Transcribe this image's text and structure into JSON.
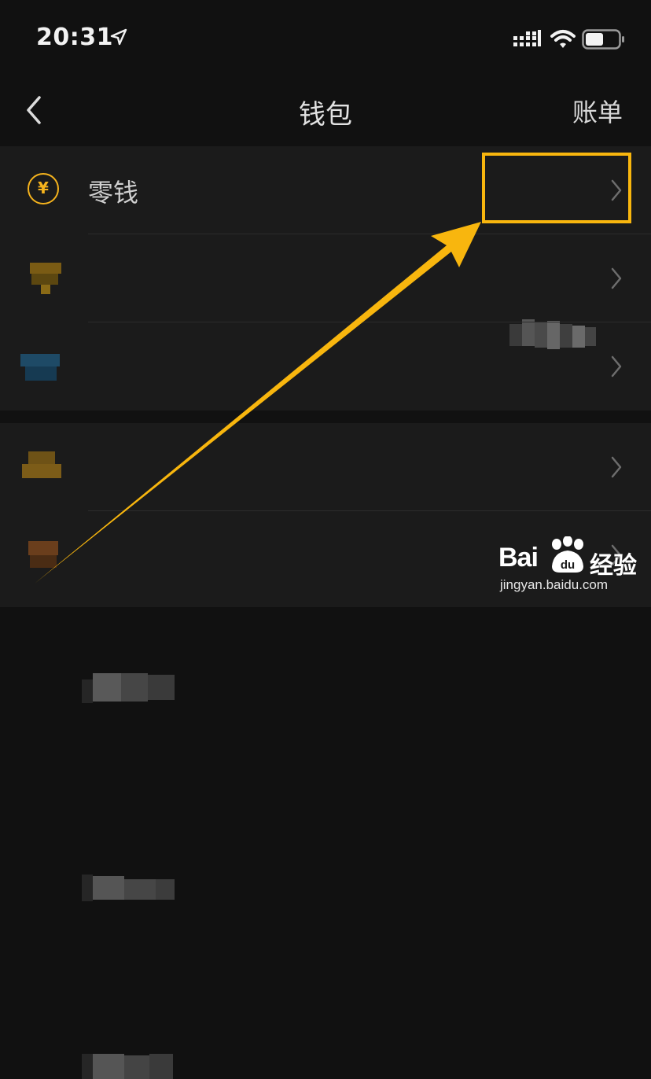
{
  "status_bar": {
    "time": "20:31",
    "icons": [
      "location-arrow-icon",
      "cellular-signal-icon",
      "wifi-icon",
      "battery-icon"
    ]
  },
  "nav": {
    "back_icon": "chevron-left-icon",
    "title": "钱包",
    "right_action": "账单"
  },
  "wallet_items": [
    {
      "label": "零钱",
      "icon": "yuan-coin-icon"
    }
  ],
  "watermark": {
    "brand_left": "Bai",
    "brand_right": "经验",
    "url": "jingyan.baidu.com"
  },
  "colors": {
    "background": "#111111",
    "row_background": "#1b1b1b",
    "highlight": "#f8b60e",
    "yuan_icon": "#f5b31d"
  }
}
